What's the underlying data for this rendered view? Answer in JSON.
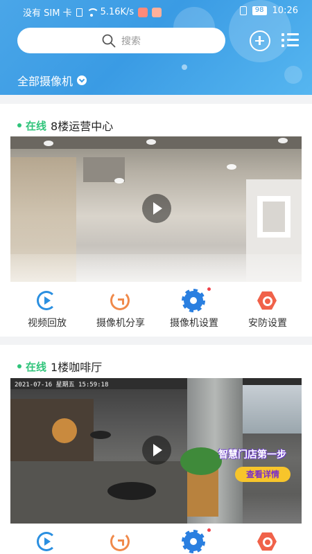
{
  "status_bar": {
    "carrier": "没有 SIM 卡",
    "speed": "5.16K/s",
    "battery": "98",
    "time": "10:26"
  },
  "header": {
    "search_placeholder": "搜索",
    "filter_label": "全部摄像机"
  },
  "cameras": [
    {
      "status": "在线",
      "name": "8楼运营中心",
      "actions": [
        "视频回放",
        "摄像机分享",
        "摄像机设置",
        "安防设置"
      ]
    },
    {
      "status": "在线",
      "name": "1楼咖啡厅",
      "osd": "2021-07-16 星期五 15:59:18",
      "promo_title": "智慧门店第一步",
      "promo_button": "查看详情"
    }
  ],
  "colors": {
    "header_blue": "#3a9be4",
    "online_green": "#2fc47a",
    "notify_red": "#f0434a"
  }
}
